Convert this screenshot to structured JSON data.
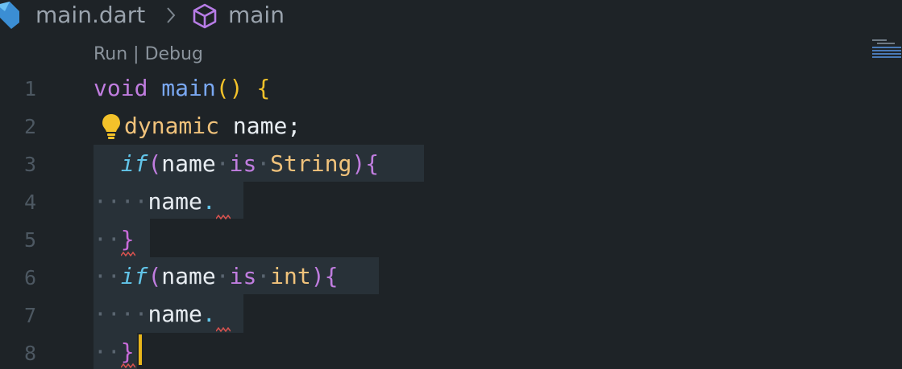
{
  "breadcrumb": {
    "file": "main.dart",
    "separator_icon": "chevron-right-icon",
    "symbol_icon": "cube-icon",
    "symbol": "main"
  },
  "codelens": {
    "text": "Run | Debug"
  },
  "line_numbers": [
    "1",
    "2",
    "3",
    "4",
    "5",
    "6",
    "7",
    "8"
  ],
  "code": {
    "l1": {
      "kw": "void",
      "fn": "main",
      "paren": "()",
      "brace": "{"
    },
    "l2": {
      "type": "dynamic",
      "name": "name",
      "semi": ";"
    },
    "l3": {
      "if": "if",
      "open": "(",
      "name": "name",
      "is": "is",
      "type": "String",
      "close": ")",
      "brace": "{"
    },
    "l4": {
      "name": "name",
      "dot": "."
    },
    "l5": {
      "brace": "}"
    },
    "l6": {
      "if": "if",
      "open": "(",
      "name": "name",
      "is": "is",
      "type": "int",
      "close": ")",
      "brace": "{"
    },
    "l7": {
      "name": "name",
      "dot": "."
    },
    "l8": {
      "brace": "}"
    }
  },
  "colors": {
    "background": "#1e2327",
    "keyword": "#c07ddf",
    "function": "#7aa8f2",
    "bracket": "#f3c22a",
    "type": "#f0c27b",
    "control": "#62c4e8",
    "caret": "#e8b51b",
    "squiggle": "#d9534f"
  }
}
